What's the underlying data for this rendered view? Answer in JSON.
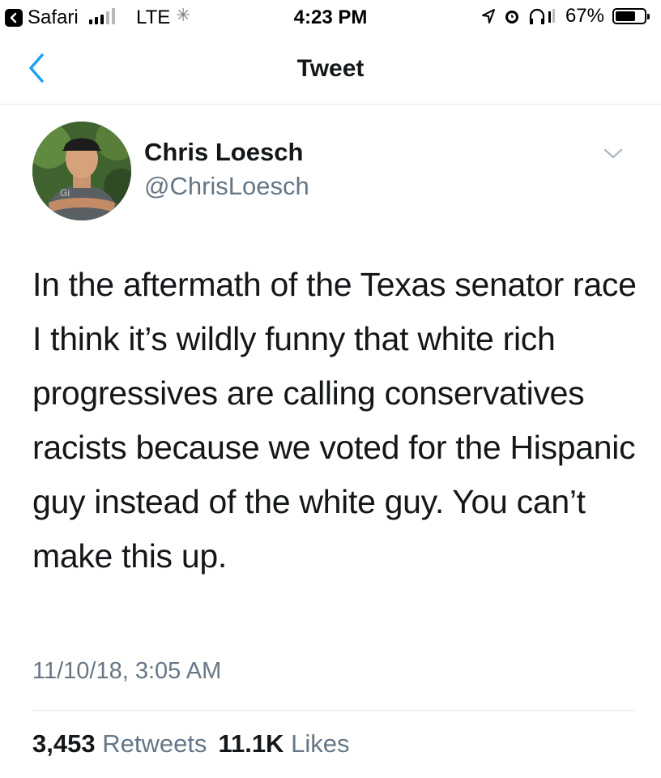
{
  "status_bar": {
    "back_app": "Safari",
    "carrier": "LTE",
    "time": "4:23 PM",
    "battery": "67%"
  },
  "nav": {
    "title": "Tweet"
  },
  "tweet": {
    "author_name": "Chris Loesch",
    "author_handle": "@ChrisLoesch",
    "text": "In the aftermath of the Texas senator race I think it’s wildly funny that white rich progressives are calling conservatives racists because we voted for the Hispanic guy instead of the white guy. You can’t make this up.",
    "timestamp": "11/10/18, 3:05 AM",
    "retweets_count": "3,453",
    "retweets_label": "Retweets",
    "likes_count": "11.1K",
    "likes_label": "Likes"
  },
  "colors": {
    "twitter_blue": "#1da1f2",
    "secondary_text": "#657786",
    "primary_text": "#14171a"
  },
  "icons": [
    "back-chevron-icon",
    "signal-bars-icon",
    "location-arrow-icon",
    "alarm-icon",
    "headphones-icon",
    "battery-icon",
    "caret-down-icon"
  ]
}
